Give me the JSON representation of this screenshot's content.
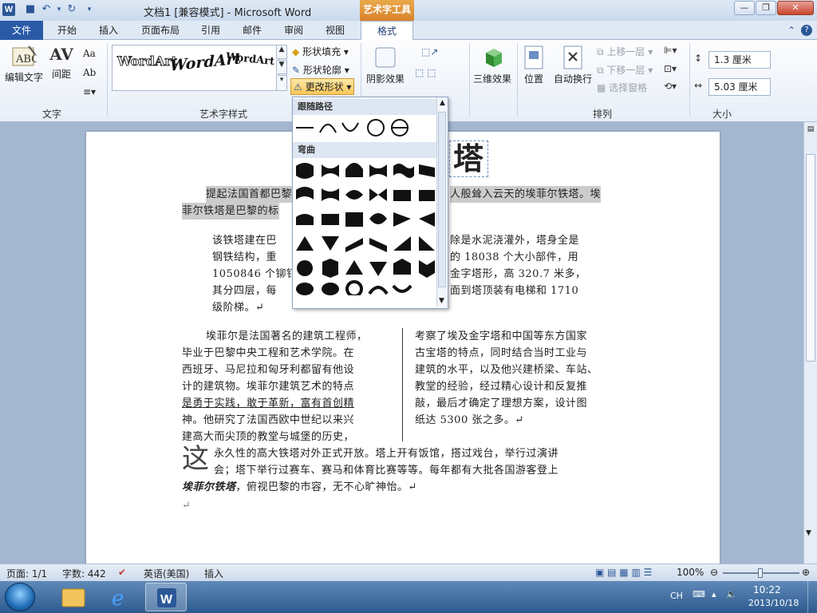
{
  "window": {
    "title": "文档1 [兼容模式] - Microsoft Word",
    "context_tool": "艺术字工具",
    "minimize": "—",
    "maximize": "❐",
    "close": "✕"
  },
  "quick_access": {
    "logo": "W",
    "save": "💾",
    "undo": "↶",
    "redo": "↻",
    "customize": "▾"
  },
  "tabs": [
    "文件",
    "开始",
    "插入",
    "页面布局",
    "引用",
    "邮件",
    "审阅",
    "视图",
    "格式"
  ],
  "ribbon": {
    "text_group": {
      "label": "文字",
      "edit_text": "编辑文字",
      "spacing": "间距",
      "spacing_icon": "AV",
      "aa": "Aa",
      "ab": "Ab"
    },
    "wordart_group": {
      "label": "艺术字样式",
      "samples": [
        "WordArt",
        "WordArt",
        "WordArt"
      ],
      "shape_fill": "形状填充",
      "shape_outline": "形状轮廓",
      "change_shape": "更改形状"
    },
    "shadow_group": {
      "label": "阴影效果"
    },
    "threed_group": {
      "label": "三维效果"
    },
    "arrange_group": {
      "label": "排列",
      "position": "位置",
      "wrap": "自动换行",
      "bring_forward": "上移一层",
      "send_backward": "下移一层",
      "selection_pane": "选择窗格"
    },
    "size_group": {
      "label": "大小",
      "height": "1.3 厘米",
      "width": "5.03 厘米"
    }
  },
  "dropdown": {
    "section1": "跟随路径",
    "section2": "弯曲"
  },
  "document": {
    "title_char": "塔",
    "para1_line1": "提起法国首都巴黎",
    "para1_line1_right": "人般耸入云天的埃菲尔铁塔。埃",
    "para1_line2": "菲尔铁塔是巴黎的标",
    "para2_lines": [
      "该铁塔建在巴",
      "钢铁结构，重",
      "1050846 个铆钉",
      "其分四层，每",
      "级阶梯。↵"
    ],
    "para2_right": [
      "除是水泥浇灌外，塔身全是",
      "的 18038 个大小部件，用",
      "金字塔形，高 320.7 米多，",
      "面到塔顶装有电梯和 1710"
    ],
    "col1": [
      "埃菲尔是法国著名的建筑工程师，",
      "毕业于巴黎中央工程和艺术学院。在",
      "西班牙、马尼拉和匈牙利都留有他设",
      "计的建筑物。埃菲尔建筑艺术的特点",
      "是勇于实践，敢于革新，富有首创精",
      "神。他研究了法国西欧中世纪以来兴",
      "建高大而尖顶的教堂与城堡的历史，"
    ],
    "col2": [
      "考察了埃及金字塔和中国等东方国家",
      "古宝塔的特点，同时结合当时工业与",
      "建筑的水平，以及他兴建桥梁、车站、",
      "教堂的经验，经过精心设计和反复推",
      "敲，最后才确定了理想方案，设计图",
      "纸达 5300 张之多。↵"
    ],
    "dropcap": "这",
    "last_line1": "永久性的高大铁塔对外正式开放。塔上开有饭馆，搭过戏台，举行过演讲",
    "last_line2": "会；塔下举行过赛车、赛马和体育比赛等等。每年都有大批各国游客登上",
    "last_line3_bold": "埃菲尔铁塔",
    "last_line3_rest": "，俯视巴黎的市容，无不心旷神怡。↵",
    "end_mark": "↵"
  },
  "status": {
    "page": "页面: 1/1",
    "words": "字数: 442",
    "language": "英语(美国)",
    "mode": "插入",
    "zoom": "100%"
  },
  "tray": {
    "lang": "CH",
    "time": "10:22",
    "date": "2013/10/18"
  },
  "colors": {
    "file_tab": "#2a5aa6",
    "context_orange": "#d9822b",
    "taskbar": "#2d5a8e"
  }
}
